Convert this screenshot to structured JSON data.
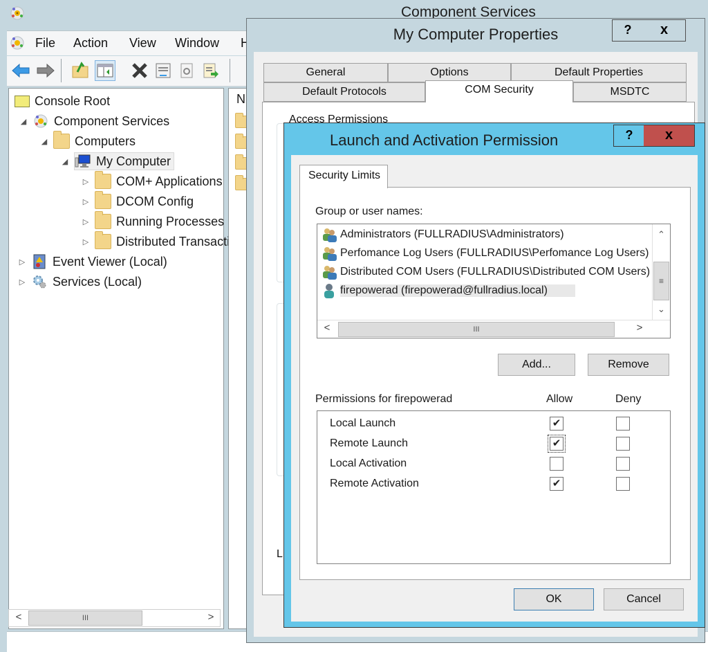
{
  "main_window": {
    "title": "Component Services",
    "menu": [
      "File",
      "Action",
      "View",
      "Window",
      "Help"
    ],
    "toolbar_icons": [
      "back-arrow-icon",
      "forward-arrow-icon",
      "up-folder-icon",
      "show-hide-console-tree-icon",
      "delete-icon",
      "properties-icon",
      "refresh-icon",
      "export-list-icon"
    ],
    "tree": [
      {
        "label": "Console Root",
        "level": 0,
        "icon": "console-root-folder-icon",
        "expander": "none"
      },
      {
        "label": "Component Services",
        "level": 1,
        "icon": "component-services-icon",
        "expander": "expanded"
      },
      {
        "label": "Computers",
        "level": 2,
        "icon": "folder-icon",
        "expander": "expanded"
      },
      {
        "label": "My Computer",
        "level": 3,
        "icon": "computer-icon",
        "expander": "expanded",
        "selected": true
      },
      {
        "label": "COM+ Applications",
        "level": 4,
        "icon": "folder-icon",
        "expander": "collapsed"
      },
      {
        "label": "DCOM Config",
        "level": 4,
        "icon": "folder-icon",
        "expander": "collapsed"
      },
      {
        "label": "Running Processes",
        "level": 4,
        "icon": "folder-icon",
        "expander": "collapsed"
      },
      {
        "label": "Distributed Transaction Coordinator",
        "level": 4,
        "icon": "folder-icon",
        "expander": "collapsed"
      },
      {
        "label": "Event Viewer (Local)",
        "level": 0,
        "icon": "event-viewer-icon",
        "expander": "collapsed"
      },
      {
        "label": "Services (Local)",
        "level": 0,
        "icon": "services-gear-icon",
        "expander": "collapsed"
      }
    ],
    "list_header_first_letter": "N",
    "scroll": {
      "left": "<",
      "right": ">",
      "thumb": "III"
    }
  },
  "properties_dialog": {
    "title": "My Computer Properties",
    "help_label": "?",
    "close_label": "x",
    "tabs_row1": [
      "General",
      "Options",
      "Default Properties"
    ],
    "tabs_row2": [
      "Default Protocols",
      "COM Security",
      "MSDTC"
    ],
    "active_tab": "COM Security",
    "group_label": "Access Permissions",
    "partial_label": "L"
  },
  "launch_dialog": {
    "title": "Launch and Activation Permission",
    "help_label": "?",
    "close_label": "x",
    "tab": "Security Limits",
    "group_label": "Group or user names:",
    "users": [
      {
        "name": "Administrators (FULLRADIUS\\Administrators)",
        "icon": "group-icon",
        "selected": false
      },
      {
        "name": "Perfomance Log Users (FULLRADIUS\\Perfomance Log Users)",
        "icon": "group-icon",
        "selected": false
      },
      {
        "name": "Distributed COM Users (FULLRADIUS\\Distributed COM Users)",
        "icon": "group-icon",
        "selected": false
      },
      {
        "name": "firepowerad (firepowerad@fullradius.local)",
        "icon": "user-icon",
        "selected": true
      }
    ],
    "list_scroll": {
      "up": "^",
      "down": "v",
      "left": "<",
      "right": ">",
      "thumb_v": "≡",
      "thumb_h": "III"
    },
    "add_label": "Add...",
    "remove_label": "Remove",
    "permissions_label": "Permissions for firepowerad",
    "allow_label": "Allow",
    "deny_label": "Deny",
    "permissions": [
      {
        "name": "Local Launch",
        "allow": true,
        "deny": false
      },
      {
        "name": "Remote Launch",
        "allow": true,
        "deny": false,
        "focused": true
      },
      {
        "name": "Local Activation",
        "allow": false,
        "deny": false
      },
      {
        "name": "Remote Activation",
        "allow": true,
        "deny": false
      }
    ],
    "ok_label": "OK",
    "cancel_label": "Cancel",
    "colors": {
      "frame": "#64c6e9",
      "close": "#c0504d"
    }
  }
}
